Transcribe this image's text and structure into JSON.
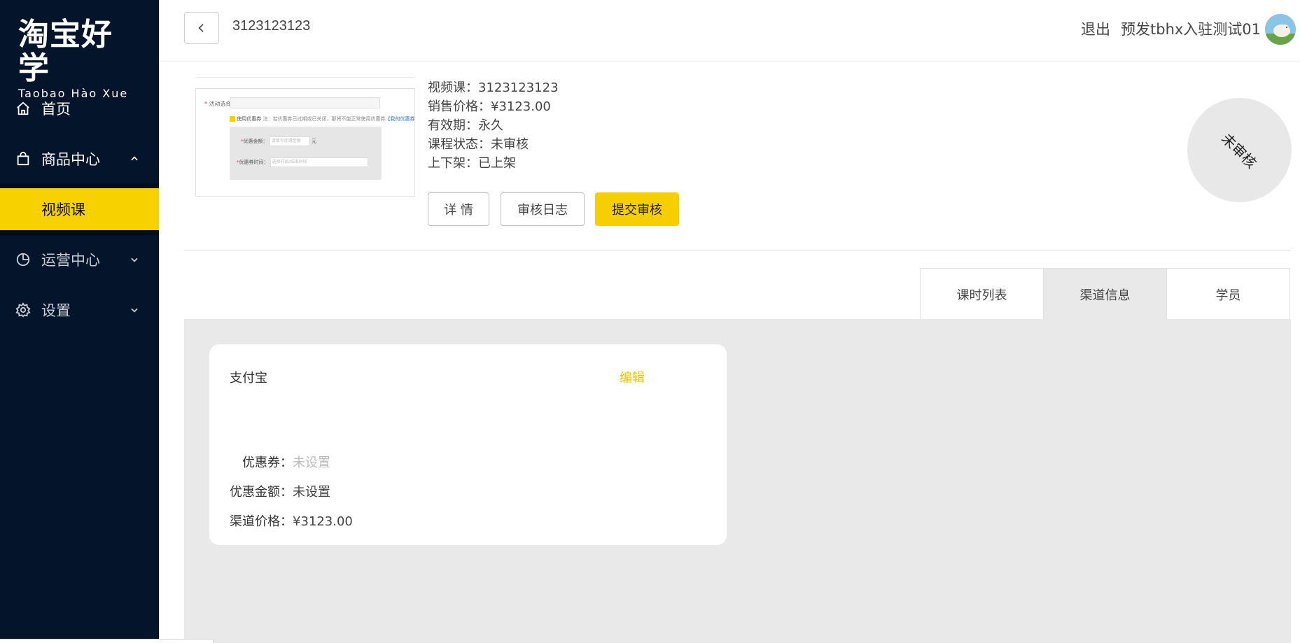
{
  "logo": {
    "cn": "淘宝好学",
    "en": "Taobao Hào Xue"
  },
  "sidebar": {
    "items": [
      {
        "label": "首页",
        "icon": "home-icon"
      },
      {
        "label": "商品中心",
        "icon": "bag-icon"
      },
      {
        "label": "视频课"
      },
      {
        "label": "运营中心",
        "icon": "pie-chart-icon"
      },
      {
        "label": "设置",
        "icon": "gear-icon"
      }
    ]
  },
  "header": {
    "title": "3123123123",
    "logout": "退出",
    "username": "预发tbhx入驻测试01"
  },
  "course": {
    "video": "视频课：3123123123",
    "price": "销售价格：¥3123.00",
    "validity": "有效期：永久",
    "status": "课程状态：未审核",
    "shelf": "上下架：已上架"
  },
  "actions": {
    "detail": "详 情",
    "audit_log": "审核日志",
    "submit": "提交审核"
  },
  "status_badge": "未审核",
  "tabs": [
    {
      "label": "课时列表"
    },
    {
      "label": "渠道信息"
    },
    {
      "label": "学员"
    }
  ],
  "channel_card": {
    "title": "支付宝",
    "edit": "编辑",
    "coupon_label": "优惠券：",
    "coupon_value": "未设置",
    "discount_label": "优惠金额：",
    "discount_value": "未设置",
    "channel_price_label": "渠道价格：",
    "channel_price_value": "¥3123.00"
  },
  "thumbnail": {
    "label": "活动选择",
    "coupon_check": "使用优惠券",
    "note": "注：若优惠券已过期或已关闭，那将不能正常使用优惠券",
    "link": "【我的优惠券】",
    "amount_label": "优惠金额：",
    "amount_placeholder": "请填写优惠金额",
    "amount_unit": "元",
    "time_label": "优惠券时间：",
    "time_placeholder": "选择开始/结束时间"
  },
  "colors": {
    "sidebar_bg": "#04142b",
    "accent": "#f7cf00",
    "content_bg": "#e9e9e9"
  }
}
